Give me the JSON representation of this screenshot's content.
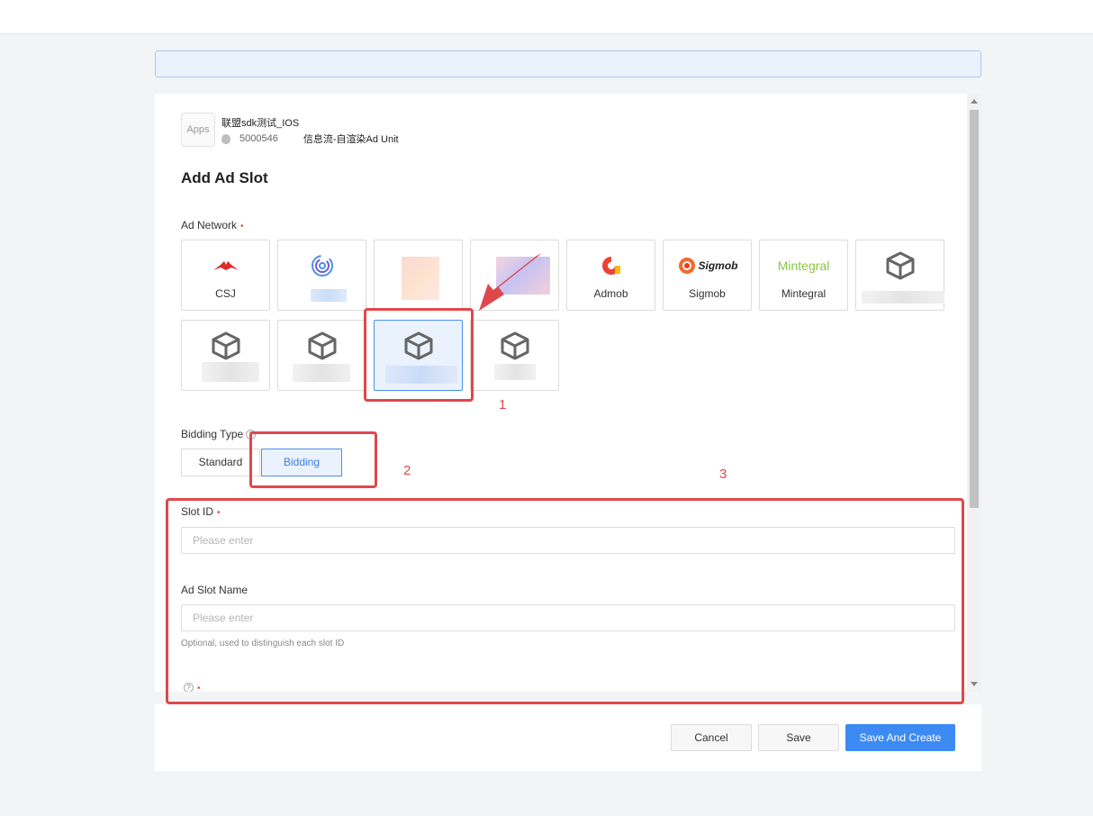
{
  "app": {
    "icon_label": "Apps",
    "name": "联盟sdk测试_IOS",
    "id": "5000546",
    "unit": "信息流-自渲染Ad Unit"
  },
  "page_title": "Add Ad Slot",
  "ad_network": {
    "label": "Ad Network",
    "required_mark": "•",
    "tiles": [
      {
        "label": "CSJ",
        "icon": "csj-logo",
        "selected": false
      },
      {
        "label": "",
        "icon": "concentric-circles-logo",
        "selected": false
      },
      {
        "label": "",
        "icon": "blurred-logo",
        "selected": false
      },
      {
        "label": "",
        "icon": "blurred-logo",
        "selected": false
      },
      {
        "label": "Admob",
        "icon": "admob-logo",
        "selected": false
      },
      {
        "label": "Sigmob",
        "icon": "sigmob-logo",
        "selected": false
      },
      {
        "label": "Mintegral",
        "icon": "mintegral-logo",
        "selected": false
      },
      {
        "label": "",
        "icon": "box-icon",
        "selected": false
      },
      {
        "label": "",
        "icon": "box-icon",
        "selected": false
      },
      {
        "label": "",
        "icon": "box-icon",
        "selected": false
      },
      {
        "label": "",
        "icon": "box-icon",
        "selected": true
      },
      {
        "label": "",
        "icon": "box-icon",
        "selected": false
      }
    ],
    "logo_text": {
      "sigmob": "Sigmob",
      "mintegral": "Mintegral"
    }
  },
  "bidding_type": {
    "label": "Bidding Type",
    "help": "?",
    "options": [
      "Standard",
      "Bidding"
    ],
    "selected": "Bidding"
  },
  "slot_id": {
    "label": "Slot ID",
    "required_mark": "•",
    "placeholder": "Please enter",
    "value": ""
  },
  "slot_name": {
    "label": "Ad Slot Name",
    "placeholder": "Please enter",
    "value": "",
    "hint": "Optional, used to distinguish each slot ID"
  },
  "next_field": {
    "help": "?",
    "required_mark": "•"
  },
  "footer": {
    "cancel": "Cancel",
    "save": "Save",
    "save_create": "Save And Create"
  },
  "annotations": {
    "n1": "1",
    "n2": "2",
    "n3": "3",
    "color": "#e0474c"
  },
  "colors": {
    "primary": "#3d8bf2",
    "selected_bg": "#eaf2fe",
    "required": "#f04a4a"
  }
}
